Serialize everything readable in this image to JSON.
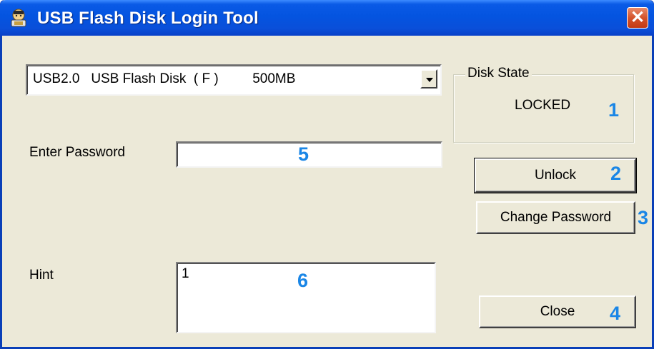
{
  "window": {
    "title": "USB Flash Disk Login Tool",
    "close_glyph": "✕",
    "app_icon": "usb-login-app-icon",
    "title_bar_color": "#0454e0",
    "face_color": "#ece9d8"
  },
  "device_select": {
    "selected": "USB2.0   USB Flash Disk  ( F )         500MB"
  },
  "disk_state": {
    "legend": "Disk State",
    "value": "LOCKED"
  },
  "password": {
    "label": "Enter Password",
    "value": ""
  },
  "hint": {
    "label": "Hint",
    "value": "1"
  },
  "buttons": {
    "unlock": "Unlock",
    "change_password": "Change Password",
    "close": "Close"
  },
  "callouts": {
    "n1": "1",
    "n2": "2",
    "n3": "3",
    "n4": "4",
    "n5": "5",
    "n6": "6",
    "color": "#1a86e6"
  }
}
